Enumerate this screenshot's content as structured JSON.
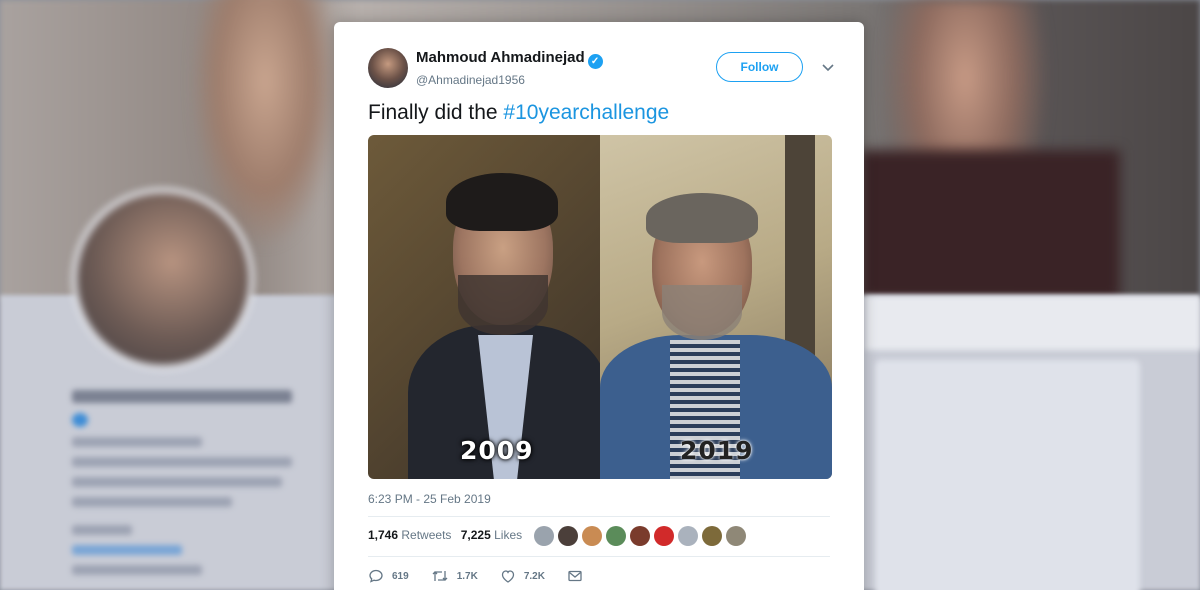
{
  "tweet": {
    "display_name": "Mahmoud Ahmadinejad",
    "handle": "@Ahmadinejad1956",
    "follow_label": "Follow",
    "text_prefix": "Finally did the ",
    "hashtag": "#10yearchallenge",
    "photo_left_label": "2009",
    "photo_right_label": "2019",
    "timestamp": "6:23 PM - 25 Feb 2019",
    "retweets_count": "1,746",
    "retweets_label": "Retweets",
    "likes_count": "7,225",
    "likes_label": "Likes",
    "reply_count": "619",
    "retweet_action_count": "1.7K",
    "like_action_count": "7.2K"
  },
  "colors": {
    "accent": "#1da1f2",
    "hashtag": "#1b95e0",
    "muted_text": "#657786"
  },
  "icons": {
    "verified": "verified-badge-icon",
    "chevron": "chevron-down-icon",
    "reply": "reply-icon",
    "retweet": "retweet-icon",
    "like": "heart-icon",
    "dm": "envelope-icon"
  }
}
